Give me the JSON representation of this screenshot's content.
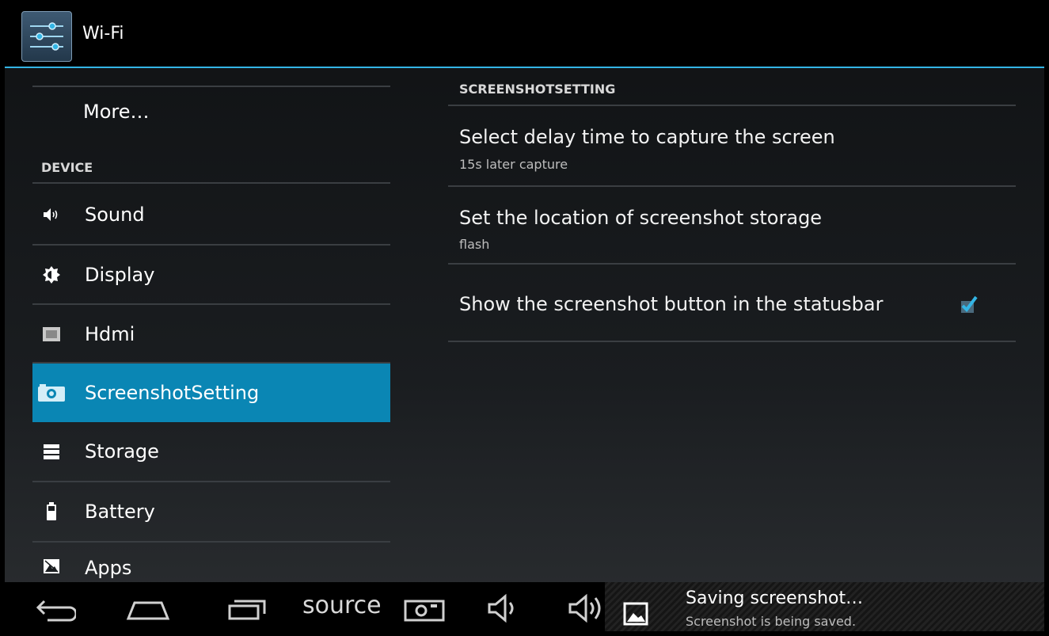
{
  "action_bar": {
    "title": "Wi-Fi",
    "icon": "settings-sliders-icon"
  },
  "sidebar": {
    "more_label": "More…",
    "device_header": "DEVICE",
    "items": [
      {
        "label": "Sound",
        "icon": "speaker-icon"
      },
      {
        "label": "Display",
        "icon": "brightness-icon"
      },
      {
        "label": "Hdmi",
        "icon": "hdmi-icon"
      },
      {
        "label": "ScreenshotSetting",
        "icon": "camera-icon",
        "selected": true
      },
      {
        "label": "Storage",
        "icon": "storage-icon"
      },
      {
        "label": "Battery",
        "icon": "battery-icon"
      },
      {
        "label": "Apps",
        "icon": "apps-icon"
      }
    ]
  },
  "content": {
    "section_header": "SCREENSHOTSETTING",
    "prefs": [
      {
        "title": "Select delay time to capture the screen",
        "summary": "15s later capture"
      },
      {
        "title": "Set the location of screenshot storage",
        "summary": "flash"
      },
      {
        "title": "Show the screenshot button in the statusbar",
        "checked": true
      }
    ]
  },
  "navbar": {
    "source_label": "source",
    "notification_title": "Saving screenshot…",
    "notification_text": "Screenshot is being saved."
  },
  "colors": {
    "accent": "#33b5e5",
    "selected": "#0a86b4"
  }
}
